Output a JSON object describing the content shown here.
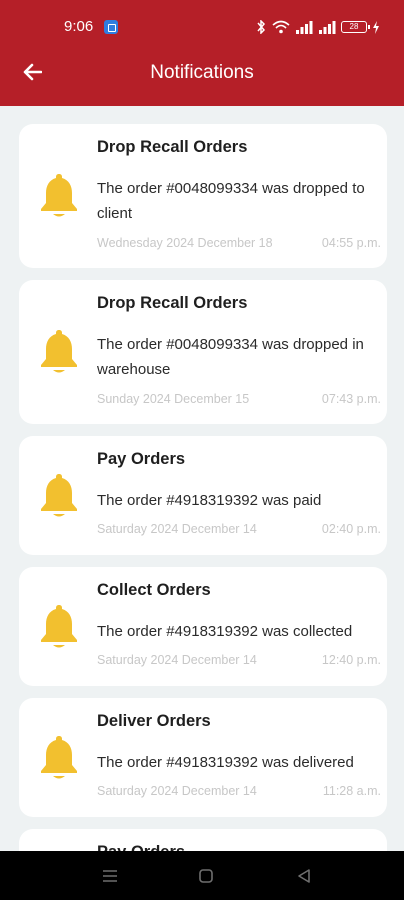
{
  "status_bar": {
    "time": "9:06",
    "battery": "28"
  },
  "app_bar": {
    "title": "Notifications",
    "back_icon": "arrow-left-icon"
  },
  "colors": {
    "primary": "#b51f28",
    "bell": "#f2c02f",
    "background": "#eef2f3",
    "muted_text": "#c7c7c7"
  },
  "notifications": [
    {
      "title": "Drop Recall Orders",
      "message": "The order #0048099334 was dropped to client",
      "date": "Wednesday 2024 December 18",
      "time": "04:55 p.m.",
      "icon": "bell-icon"
    },
    {
      "title": "Drop Recall Orders",
      "message": "The order #0048099334 was dropped in warehouse",
      "date": "Sunday 2024 December 15",
      "time": "07:43 p.m.",
      "icon": "bell-icon"
    },
    {
      "title": "Pay Orders",
      "message": "The order #4918319392 was paid",
      "date": "Saturday 2024 December 14",
      "time": "02:40 p.m.",
      "icon": "bell-icon"
    },
    {
      "title": "Collect Orders",
      "message": "The order #4918319392 was collected",
      "date": "Saturday 2024 December 14",
      "time": "12:40 p.m.",
      "icon": "bell-icon"
    },
    {
      "title": "Deliver Orders",
      "message": "The order #4918319392 was delivered",
      "date": "Saturday 2024 December 14",
      "time": "11:28 a.m.",
      "icon": "bell-icon"
    },
    {
      "title": "Pay Orders"
    }
  ]
}
